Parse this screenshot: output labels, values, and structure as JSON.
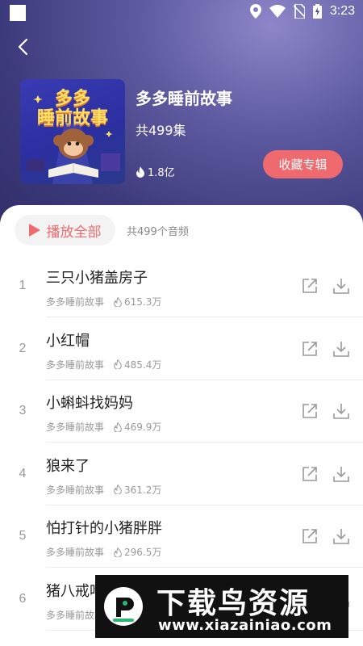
{
  "status_bar": {
    "time": "3:23"
  },
  "album": {
    "cover_text_line1": "多多",
    "cover_text_line2": "睡前故事",
    "title": "多多睡前故事",
    "episode_count": "共499集",
    "plays": "1.8亿",
    "favorite_label": "收藏专辑"
  },
  "list": {
    "play_all_label": "播放全部",
    "audio_count": "共499个音频",
    "tracks": [
      {
        "index": "1",
        "title": "三只小猪盖房子",
        "author": "多多睡前故事",
        "plays": "615.3万"
      },
      {
        "index": "2",
        "title": "小红帽",
        "author": "多多睡前故事",
        "plays": "485.4万"
      },
      {
        "index": "3",
        "title": "小蝌蚪找妈妈",
        "author": "多多睡前故事",
        "plays": "469.9万"
      },
      {
        "index": "4",
        "title": "狼来了",
        "author": "多多睡前故事",
        "plays": "361.2万"
      },
      {
        "index": "5",
        "title": "怕打针的小猪胖胖",
        "author": "多多睡前故事",
        "plays": "296.5万"
      },
      {
        "index": "6",
        "title": "猪八戒吃",
        "author": "多多睡前故",
        "plays": ""
      }
    ]
  },
  "watermark": {
    "title": "下载鸟资源",
    "url": "www.xiazainiao.com"
  },
  "colors": {
    "accent": "#ee6a6f",
    "header_dark": "#3d3a7c",
    "header_light": "#8d86c9"
  }
}
